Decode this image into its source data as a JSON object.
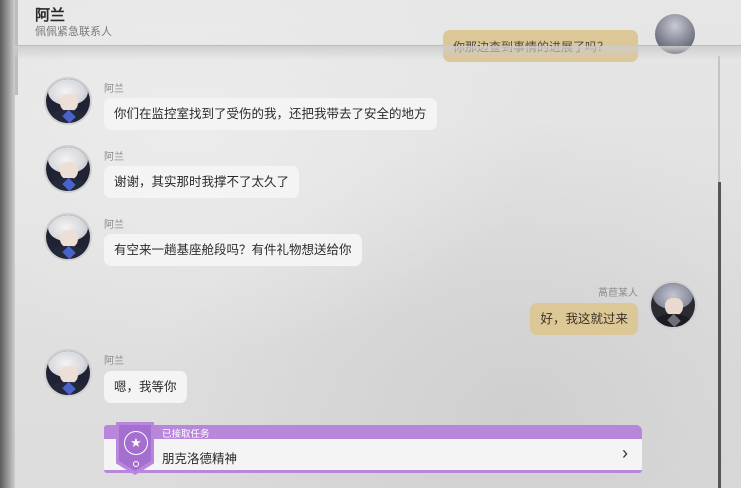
{
  "header": {
    "title": "阿兰",
    "subtitle": "佩佩紧急联系人"
  },
  "previous_message": {
    "text": "你那边查到事情的进展了吗？"
  },
  "messages": [
    {
      "sender": "阿兰",
      "text": "你们在监控室找到了受伤的我，还把我带去了安全的地方"
    },
    {
      "sender": "阿兰",
      "text": "谢谢，其实那时我撑不了太久了"
    },
    {
      "sender": "阿兰",
      "text": "有空来一趟基座舱段吗？有件礼物想送给你"
    },
    {
      "sender": "萵苣某人",
      "text": "好，我这就过来"
    },
    {
      "sender": "阿兰",
      "text": "嗯，我等你"
    }
  ],
  "quest": {
    "status_label": "已接取任务",
    "title": "朋克洛德精神",
    "star_icon": "★",
    "arrow_icon": "›"
  },
  "icons": {
    "avatar_alan": "avatar-icon",
    "avatar_me": "avatar-icon",
    "quest": "star-badge-icon",
    "chevron": "chevron-right-icon"
  },
  "colors": {
    "my_bubble": "#dcc796",
    "other_bubble": "#f4f4f4",
    "quest_accent": "#b887dc"
  }
}
